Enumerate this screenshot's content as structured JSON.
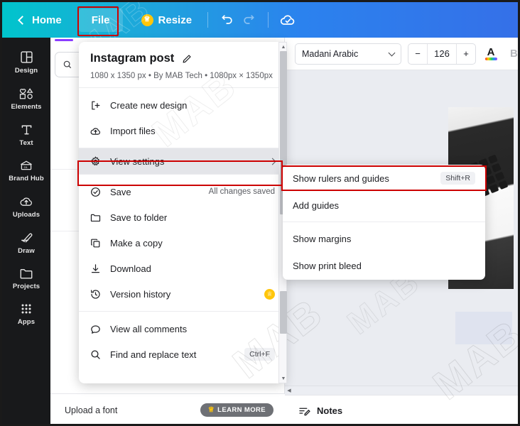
{
  "topbar": {
    "home_label": "Home",
    "file_label": "File",
    "resize_label": "Resize",
    "back_icon": "chevron-left-icon",
    "crown_icon": "crown-icon",
    "undo_icon": "undo-icon",
    "redo_icon": "redo-icon",
    "cloud_icon": "cloud-check-icon",
    "gradient_from": "#00c4cc",
    "gradient_to": "#3570e8"
  },
  "rail": {
    "items": [
      {
        "label": "Design",
        "icon": "design-icon"
      },
      {
        "label": "Elements",
        "icon": "elements-icon"
      },
      {
        "label": "Text",
        "icon": "text-icon"
      },
      {
        "label": "Brand Hub",
        "icon": "brand-hub-icon"
      },
      {
        "label": "Uploads",
        "icon": "uploads-icon"
      },
      {
        "label": "Draw",
        "icon": "draw-icon"
      },
      {
        "label": "Projects",
        "icon": "projects-icon"
      },
      {
        "label": "Apps",
        "icon": "apps-icon"
      }
    ]
  },
  "left_panel": {
    "search_icon": "search-icon",
    "footer_label": "Upload a font",
    "learn_more_label": "LEARN MORE",
    "learn_more_icon": "crown-icon"
  },
  "canvas_toolbar": {
    "font_name": "Madani Arabic",
    "font_dropdown_icon": "chevron-down-icon",
    "size_minus": "−",
    "size_value": "126",
    "size_plus": "+",
    "text_color_label": "A",
    "text_color_icon": "text-color-icon",
    "bold_label": "B"
  },
  "canvas": {
    "notes_label": "Notes",
    "notes_icon": "notes-icon",
    "scroll_left_icon": "scroll-left-arrow-icon"
  },
  "file_menu": {
    "design_title": "Instagram post",
    "edit_icon": "pencil-icon",
    "design_meta": "1080 x 1350 px • By MAB Tech • 1080px × 1350px",
    "items": [
      {
        "label": "Create new design",
        "icon": "create-new-design-icon",
        "right": "",
        "kind": "plain"
      },
      {
        "label": "Import files",
        "icon": "import-files-icon",
        "right": "",
        "kind": "plain"
      },
      {
        "label": "View settings",
        "icon": "gear-icon",
        "right": "",
        "kind": "submenu",
        "selected": true
      },
      {
        "label": "Save",
        "icon": "save-cloud-icon",
        "right": "All changes saved",
        "kind": "plain"
      },
      {
        "label": "Save to folder",
        "icon": "folder-icon",
        "right": "",
        "kind": "plain"
      },
      {
        "label": "Make a copy",
        "icon": "copy-icon",
        "right": "",
        "kind": "plain"
      },
      {
        "label": "Download",
        "icon": "download-icon",
        "right": "",
        "kind": "plain"
      },
      {
        "label": "Version history",
        "icon": "history-icon",
        "right": "",
        "kind": "pro"
      },
      {
        "label": "View all comments",
        "icon": "comment-icon",
        "right": "",
        "kind": "plain"
      },
      {
        "label": "Find and replace text",
        "icon": "search-icon",
        "right": "Ctrl+F",
        "kind": "kbd"
      }
    ],
    "scroll_up_icon": "scroll-up-arrow-icon",
    "scroll_down_icon": "scroll-down-arrow-icon",
    "chevron_right_icon": "chevron-right-icon"
  },
  "submenu": {
    "items": [
      {
        "label": "Show rulers and guides",
        "shortcut": "Shift+R"
      },
      {
        "label": "Add guides",
        "shortcut": ""
      },
      {
        "label": "Show margins",
        "shortcut": ""
      },
      {
        "label": "Show print bleed",
        "shortcut": ""
      }
    ]
  },
  "highlights": {
    "color": "#cc0000",
    "targets": [
      "file-tab",
      "view-settings-item",
      "show-rulers-and-guides-item"
    ]
  },
  "watermark": {
    "text": "MAB"
  }
}
